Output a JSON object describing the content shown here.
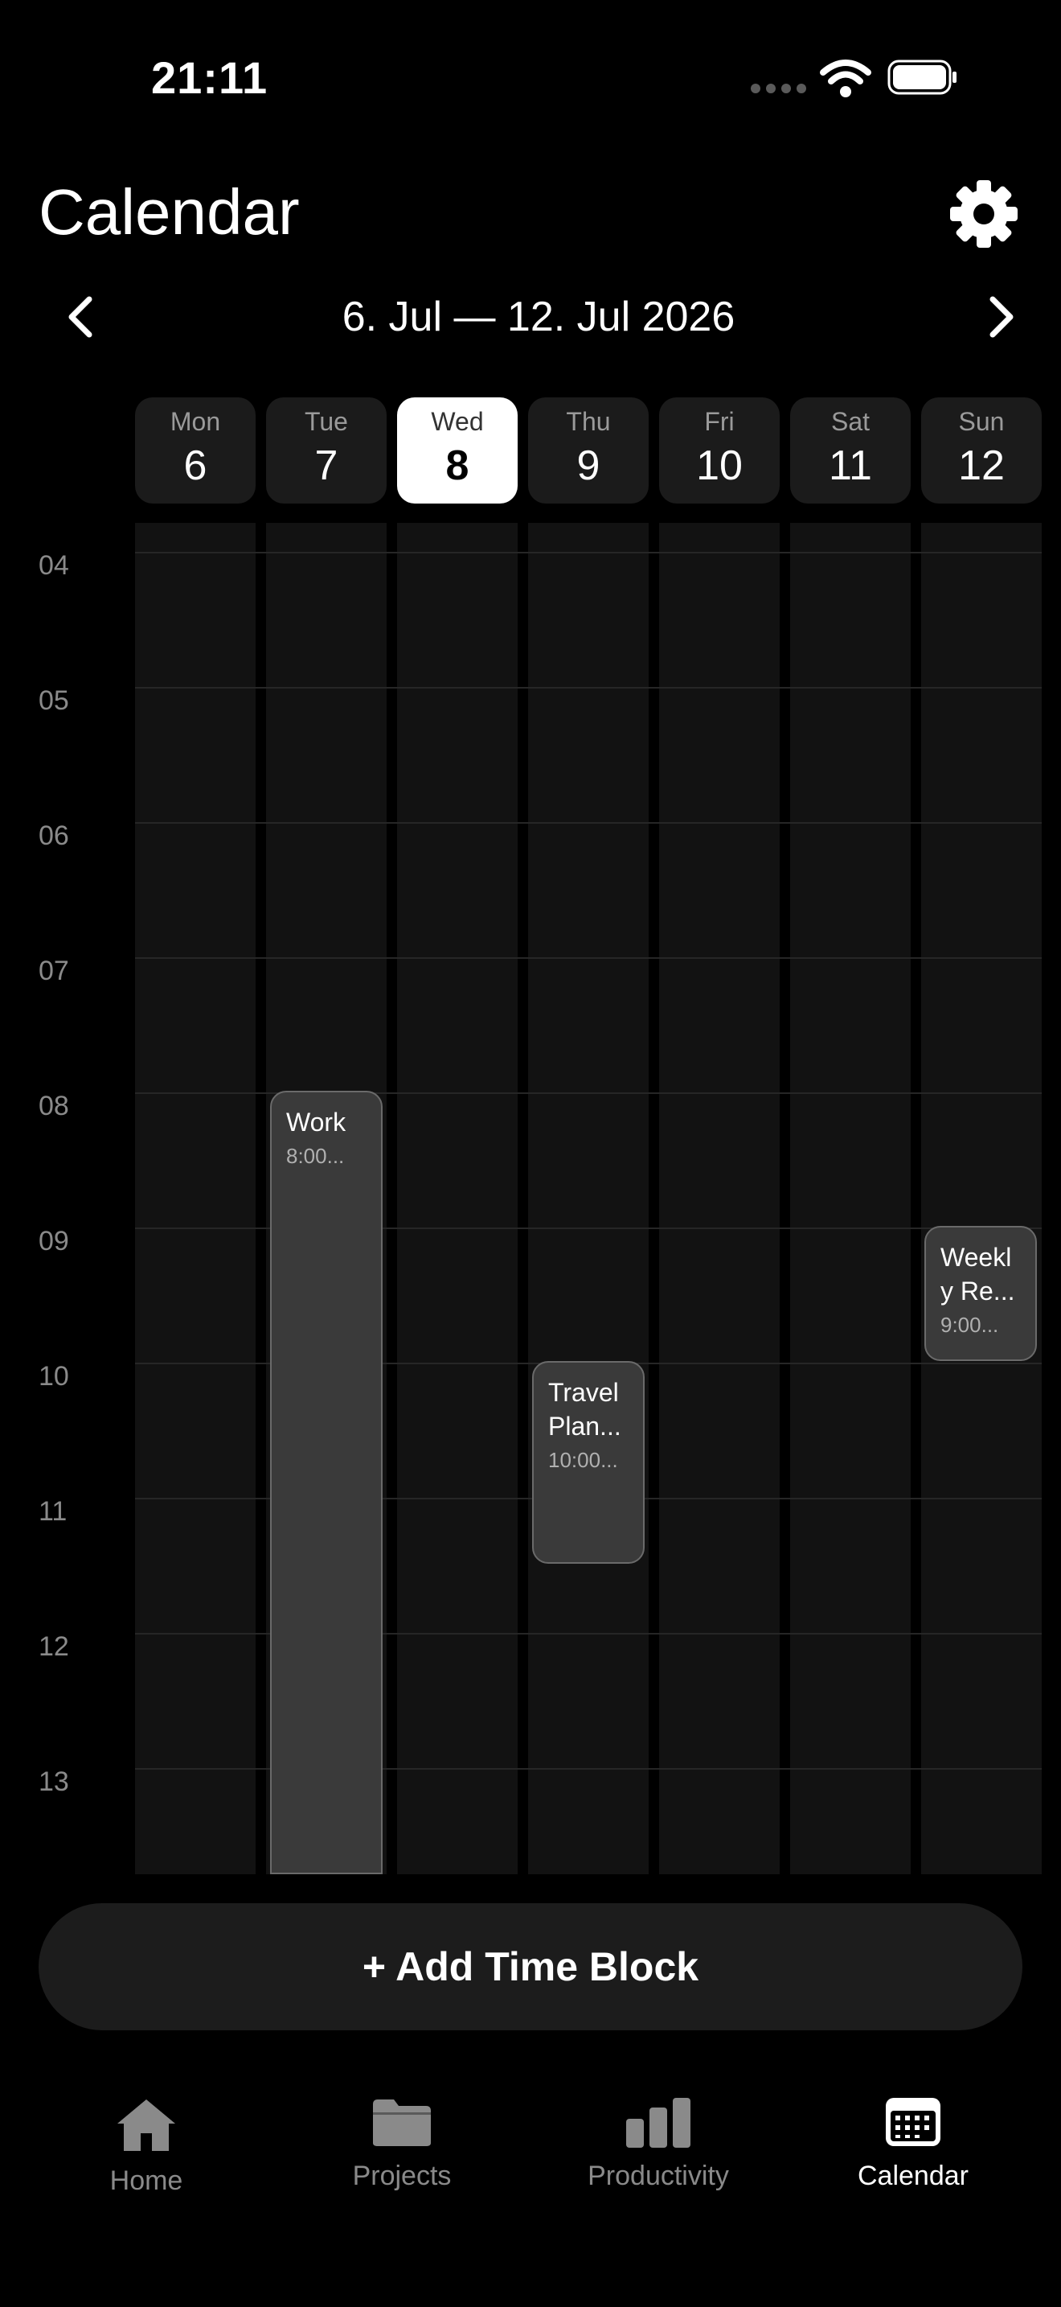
{
  "status_bar": {
    "time": "21:11"
  },
  "header": {
    "title": "Calendar",
    "date_range": "6. Jul — 12. Jul 2026"
  },
  "days": [
    {
      "name": "Mon",
      "date": "6"
    },
    {
      "name": "Tue",
      "date": "7"
    },
    {
      "name": "Wed",
      "date": "8",
      "selected": true
    },
    {
      "name": "Thu",
      "date": "9"
    },
    {
      "name": "Fri",
      "date": "10"
    },
    {
      "name": "Sat",
      "date": "11"
    },
    {
      "name": "Sun",
      "date": "12"
    }
  ],
  "hours": [
    "04",
    "05",
    "06",
    "07",
    "08",
    "09",
    "10",
    "11",
    "12",
    "13"
  ],
  "events": [
    {
      "title": "Work",
      "time": "8:00...",
      "day": "Tue"
    },
    {
      "title": "Travel Plan...",
      "time": "10:00...",
      "day": "Thu"
    },
    {
      "title": "Weekly Re...",
      "time": "9:00...",
      "day": "Sun"
    }
  ],
  "add_button": {
    "label": "+ Add Time Block"
  },
  "tabs": [
    {
      "label": "Home",
      "icon": "home-icon"
    },
    {
      "label": "Projects",
      "icon": "folder-icon"
    },
    {
      "label": "Productivity",
      "icon": "bar-chart-icon"
    },
    {
      "label": "Calendar",
      "icon": "calendar-icon",
      "active": true
    }
  ]
}
